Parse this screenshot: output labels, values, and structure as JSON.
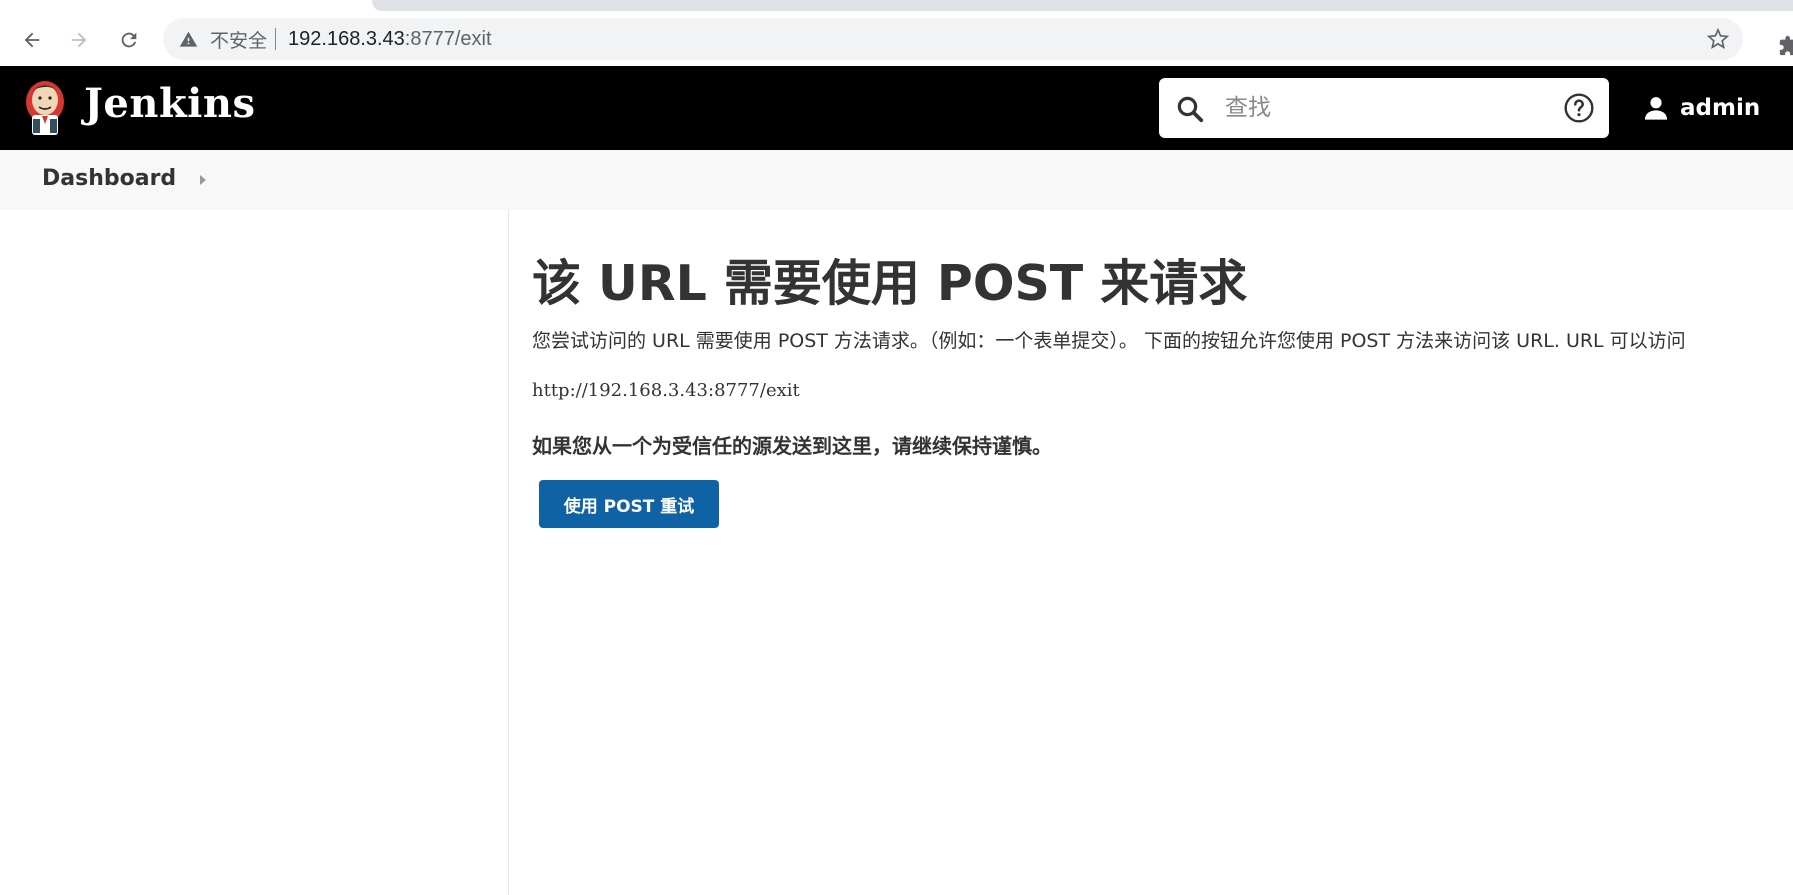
{
  "browser": {
    "security_label": "不安全",
    "url_host": "192.168.3.43",
    "url_rest": ":8777/exit"
  },
  "header": {
    "app_name": "Jenkins",
    "search_placeholder": "查找",
    "user_name": "admin"
  },
  "breadcrumb": {
    "items": [
      {
        "label": "Dashboard"
      }
    ]
  },
  "main": {
    "title": "该 URL 需要使用 POST 来请求",
    "description": "您尝试访问的 URL 需要使用 POST 方法请求。（例如：一个表单提交）。 下面的按钮允许您使用 POST 方法来访问该 URL. URL 可以访问",
    "target_url": "http://192.168.3.43:8777/exit",
    "warning": "如果您从一个为受信任的源发送到这里，请继续保持谨慎。",
    "retry_button_label": "使用 POST 重试"
  },
  "colors": {
    "header_bg": "#000000",
    "breadcrumb_bg": "#f8f8f8",
    "primary_button": "#0f62a3",
    "omnibox_bg": "#f1f3f4"
  },
  "icons": {
    "back": "arrow-left-icon",
    "forward": "arrow-right-icon",
    "reload": "reload-icon",
    "warning": "warning-triangle-icon",
    "bookmark": "star-icon",
    "extensions": "puzzle-icon",
    "search": "search-icon",
    "help": "help-circle-icon",
    "user": "user-icon"
  }
}
